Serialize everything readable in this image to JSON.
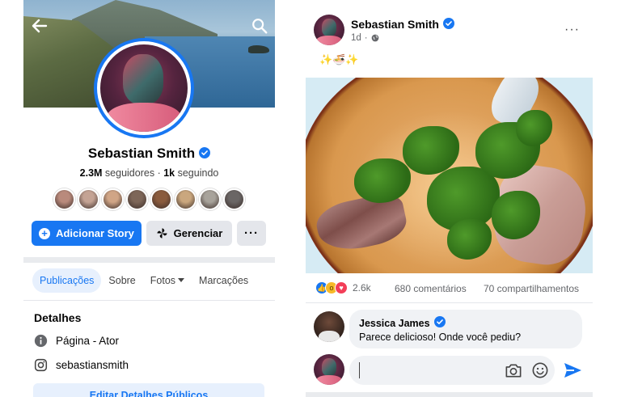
{
  "profile": {
    "name": "Sebastian Smith",
    "followers_count": "2.3M",
    "followers_label": "seguidores",
    "separator": "·",
    "following_count": "1k",
    "following_label": "seguindo",
    "buttons": {
      "add_story": "Adicionar Story",
      "manage": "Gerenciar",
      "more": "···"
    },
    "tabs": [
      {
        "label": "Publicações",
        "active": true
      },
      {
        "label": "Sobre",
        "active": false
      },
      {
        "label": "Fotos",
        "active": false
      },
      {
        "label": "Marcações",
        "active": false
      }
    ],
    "details": {
      "title": "Detalhes",
      "items": [
        {
          "icon": "info-icon",
          "text": "Página - Ator"
        },
        {
          "icon": "instagram-icon",
          "text": "sebastiansmith"
        }
      ],
      "edit_button": "Editar Detalhes Públicos"
    },
    "friend_colors": [
      "#b98a7c",
      "#c4a394",
      "#d0a586",
      "#7d6658",
      "#8a5b3d",
      "#caa77e",
      "#a8a39b",
      "#6a6665"
    ]
  },
  "post": {
    "author": "Sebastian Smith",
    "time": "1d",
    "time_separator": "·",
    "more": "···",
    "text": "✨🍜✨",
    "reactions": {
      "count": "2.6k",
      "comments": "680 comentários",
      "shares": "70 compartilhamentos"
    },
    "comment": {
      "author": "Jessica James",
      "text": "Parece delicioso! Onde você pediu?"
    },
    "write_comment": {
      "value": ""
    }
  },
  "colors": {
    "accent": "#1877f2",
    "light_accent": "#e7f0fd",
    "button_gray": "#e4e6eb",
    "bubble": "#f0f2f5",
    "secondary_text": "#65676b"
  }
}
